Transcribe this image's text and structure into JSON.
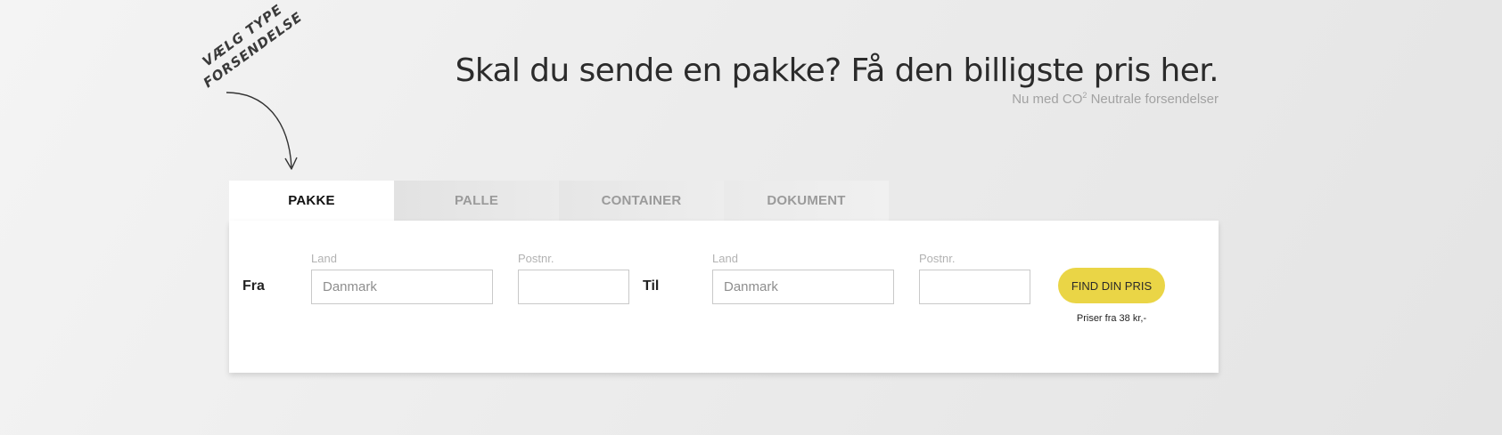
{
  "hint": {
    "line1": "VÆLG TYPE",
    "line2": "FORSENDELSE"
  },
  "headline": {
    "title": "Skal du sende en pakke? Få den billigste pris her.",
    "subtitle_prefix": "Nu med CO",
    "subtitle_sup": "2",
    "subtitle_suffix": " Neutrale forsendelser"
  },
  "tabs": [
    {
      "label": "PAKKE",
      "active": true
    },
    {
      "label": "PALLE",
      "active": false
    },
    {
      "label": "CONTAINER",
      "active": false
    },
    {
      "label": "DOKUMENT",
      "active": false
    }
  ],
  "form": {
    "from_label": "Fra",
    "to_label": "Til",
    "from_country": {
      "caption": "Land",
      "placeholder": "Danmark",
      "value": ""
    },
    "from_postal": {
      "caption": "Postnr.",
      "placeholder": "",
      "value": ""
    },
    "to_country": {
      "caption": "Land",
      "placeholder": "Danmark",
      "value": ""
    },
    "to_postal": {
      "caption": "Postnr.",
      "placeholder": "",
      "value": ""
    },
    "submit_label": "FIND DIN PRIS",
    "price_note": "Priser fra 38 kr,-"
  },
  "colors": {
    "accent": "#ead546",
    "background": "#ececec",
    "card": "#ffffff"
  }
}
